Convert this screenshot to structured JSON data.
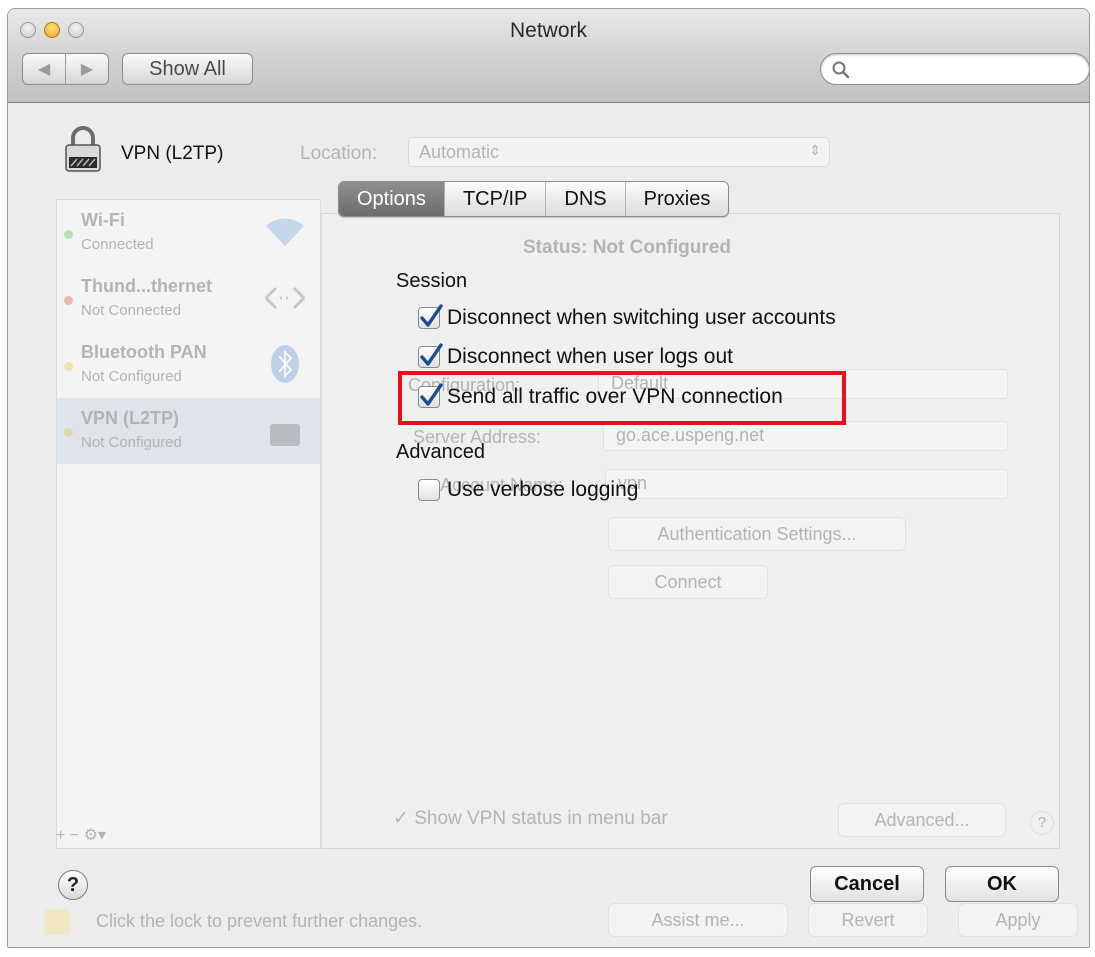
{
  "window": {
    "title": "Network"
  },
  "toolbar": {
    "back_glyph": "◀",
    "forward_glyph": "▶",
    "show_all_label": "Show All",
    "search_icon": "search-icon"
  },
  "background": {
    "service_name": "VPN (L2TP)",
    "location_label": "Location:",
    "location_value": "Automatic",
    "select_arrows": "⇕",
    "services": [
      {
        "name": "Wi-Fi",
        "status": "Connected",
        "dot": "#3bbf3b",
        "icon": "wifi-icon"
      },
      {
        "name": "Thund...thernet",
        "status": "Not Connected",
        "dot": "#e23b3b",
        "icon": "ethernet-icon"
      },
      {
        "name": "Bluetooth PAN",
        "status": "Not Configured",
        "dot": "#e8c02b",
        "icon": "bluetooth-icon"
      },
      {
        "name": "VPN (L2TP)",
        "status": "Not Configured",
        "dot": "#e8c02b",
        "icon": "vpn-lock-icon"
      }
    ],
    "sidebar_tools": "+  −  ⚙▾",
    "status_label": "Status:",
    "status_value": "Not Configured",
    "configuration_label": "Configuration:",
    "configuration_value": "Default",
    "server_label": "Server Address:",
    "server_value": "go.ace.uspeng.net",
    "account_label": "Account Name:",
    "account_value": "vpn",
    "auth_button": "Authentication Settings...",
    "connect_button": "Connect",
    "show_vpn_status": "✓ Show VPN status in menu bar",
    "advanced_button": "Advanced...",
    "help_glyph": "?",
    "lock_message": "Click the lock to prevent further changes.",
    "assist_button": "Assist me...",
    "revert_button": "Revert",
    "apply_button": "Apply"
  },
  "sheet": {
    "tabs": [
      "Options",
      "TCP/IP",
      "DNS",
      "Proxies"
    ],
    "active_tab": "Options",
    "session_heading": "Session",
    "options": [
      {
        "label": "Disconnect when switching user accounts",
        "checked": true
      },
      {
        "label": "Disconnect when user logs out",
        "checked": true
      },
      {
        "label": "Send all traffic over VPN connection",
        "checked": true
      }
    ],
    "advanced_heading": "Advanced",
    "verbose": {
      "label": "Use verbose logging",
      "checked": false
    },
    "help_glyph": "?",
    "cancel_label": "Cancel",
    "ok_label": "OK",
    "highlight_color": "#e8101a"
  }
}
